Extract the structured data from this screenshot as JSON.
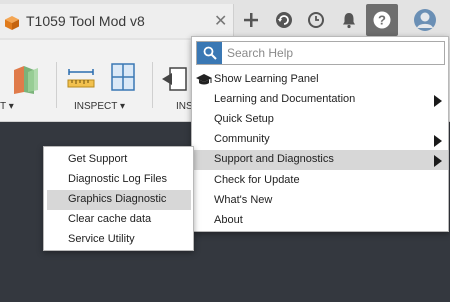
{
  "tab": {
    "title": "T1059 Tool Mod v8",
    "close_glyph": "✕",
    "icon": "cube-icon"
  },
  "titlebar": {
    "new_tab_glyph": "+",
    "buttons": [
      "add-tab-icon",
      "history-icon",
      "clock-icon",
      "notification-bell-icon",
      "help-icon",
      "user-avatar-icon"
    ]
  },
  "toolbar": {
    "partial_left_label": "T ▾",
    "inspect_label": "INSPECT ▾",
    "partial_right_label": "INS"
  },
  "help_menu": {
    "search_placeholder": "Search Help",
    "items": [
      {
        "label": "Show Learning Panel",
        "icon": "graduation-cap-icon",
        "has_submenu": false,
        "highlighted": false
      },
      {
        "label": "Learning and Documentation",
        "has_submenu": true,
        "highlighted": false
      },
      {
        "label": "Quick Setup",
        "has_submenu": false,
        "highlighted": false
      },
      {
        "label": "Community",
        "has_submenu": true,
        "highlighted": false
      },
      {
        "label": "Support and Diagnostics",
        "has_submenu": true,
        "highlighted": true
      },
      {
        "label": "Check for Update",
        "has_submenu": false,
        "highlighted": false
      },
      {
        "label": "What's New",
        "has_submenu": false,
        "highlighted": false
      },
      {
        "label": "About",
        "has_submenu": false,
        "highlighted": false
      }
    ]
  },
  "support_submenu": {
    "items": [
      {
        "label": "Get Support",
        "highlighted": false
      },
      {
        "label": "Diagnostic Log Files",
        "highlighted": false
      },
      {
        "label": "Graphics Diagnostic",
        "highlighted": true
      },
      {
        "label": "Clear cache data",
        "highlighted": false
      },
      {
        "label": "Service Utility",
        "highlighted": false
      }
    ]
  },
  "colors": {
    "accent": "#3a78b4",
    "highlight": "#d7d7d7",
    "canvas": "#34383f",
    "cube": "#e8892c"
  }
}
